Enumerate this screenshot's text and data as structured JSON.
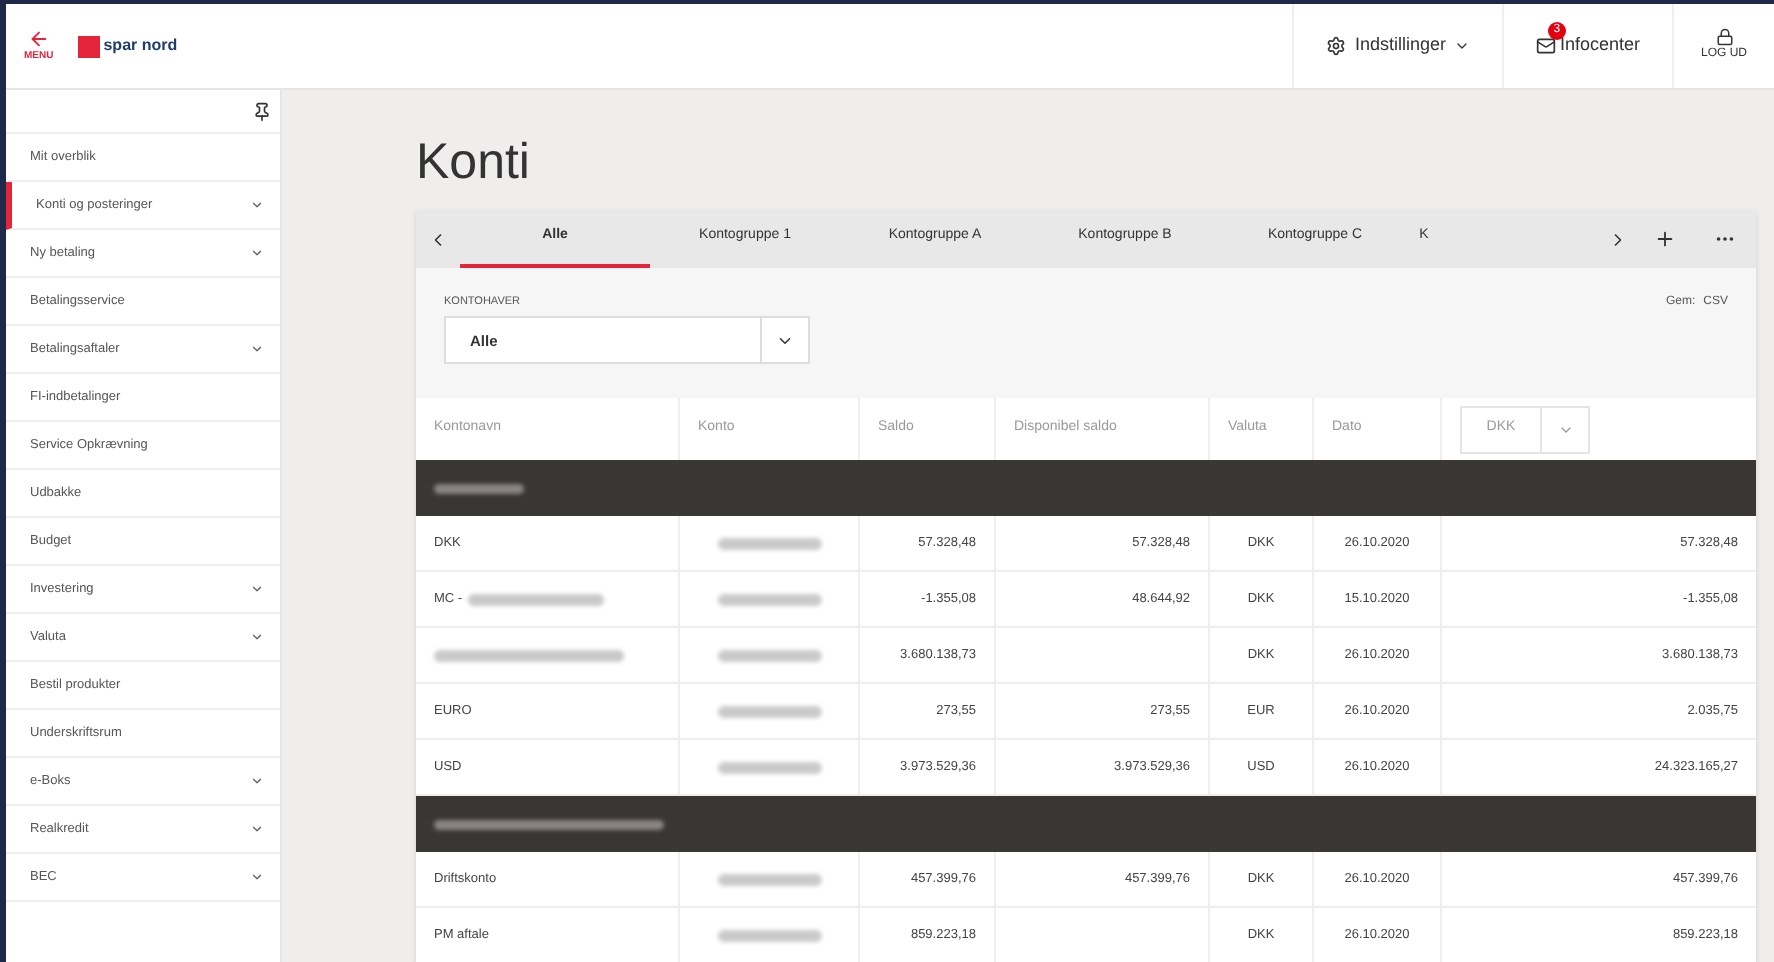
{
  "header": {
    "menu_label": "MENU",
    "logo_text": "spar nord",
    "settings_label": "Indstillinger",
    "infocenter_label": "Infocenter",
    "infocenter_badge": "3",
    "logout_label": "LOG UD"
  },
  "sidebar": {
    "items": [
      {
        "label": "Mit overblik",
        "selected": false,
        "expandable": false
      },
      {
        "label": "Konti og posteringer",
        "selected": true,
        "expandable": true
      },
      {
        "label": "Ny betaling",
        "selected": false,
        "expandable": true
      },
      {
        "label": "Betalingsservice",
        "selected": false,
        "expandable": false
      },
      {
        "label": "Betalingsaftaler",
        "selected": false,
        "expandable": true
      },
      {
        "label": "FI-indbetalinger",
        "selected": false,
        "expandable": false
      },
      {
        "label": "Service Opkrævning",
        "selected": false,
        "expandable": false
      },
      {
        "label": "Udbakke",
        "selected": false,
        "expandable": false
      },
      {
        "label": "Budget",
        "selected": false,
        "expandable": false
      },
      {
        "label": "Investering",
        "selected": false,
        "expandable": true
      },
      {
        "label": "Valuta",
        "selected": false,
        "expandable": true
      },
      {
        "label": "Bestil produkter",
        "selected": false,
        "expandable": false
      },
      {
        "label": "Underskriftsrum",
        "selected": false,
        "expandable": false
      },
      {
        "label": "e-Boks",
        "selected": false,
        "expandable": true
      },
      {
        "label": "Realkredit",
        "selected": false,
        "expandable": true
      },
      {
        "label": "BEC",
        "selected": false,
        "expandable": true
      }
    ]
  },
  "page_title": "Konti",
  "tabs": [
    {
      "label": "Alle",
      "selected": true
    },
    {
      "label": "Kontogruppe 1",
      "selected": false
    },
    {
      "label": "Kontogruppe A",
      "selected": false
    },
    {
      "label": "Kontogruppe B",
      "selected": false
    },
    {
      "label": "Kontogruppe C",
      "selected": false
    },
    {
      "label": "K",
      "selected": false
    }
  ],
  "filter": {
    "label": "KONTOHAVER",
    "value": "Alle",
    "save_label": "Gem:",
    "csv_label": "CSV"
  },
  "table": {
    "columns": [
      "Kontonavn",
      "Konto",
      "Saldo",
      "Disponibel saldo",
      "Valuta",
      "Dato"
    ],
    "currency_select": "DKK",
    "groups": [
      {
        "rows": [
          {
            "name": "DKK",
            "name_redacted": false,
            "saldo": "57.328,48",
            "disponibel": "57.328,48",
            "valuta": "DKK",
            "dato": "26.10.2020",
            "converted": "57.328,48"
          },
          {
            "name": "MC -",
            "name_redacted": true,
            "saldo": "-1.355,08",
            "disponibel": "48.644,92",
            "valuta": "DKK",
            "dato": "15.10.2020",
            "converted": "-1.355,08"
          },
          {
            "name_redacted": true,
            "saldo": "3.680.138,73",
            "valuta": "DKK",
            "dato": "26.10.2020",
            "converted": "3.680.138,73"
          },
          {
            "name": "EURO",
            "name_redacted": false,
            "saldo": "273,55",
            "disponibel": "273,55",
            "valuta": "EUR",
            "dato": "26.10.2020",
            "converted": "2.035,75"
          },
          {
            "name": "USD",
            "name_redacted": false,
            "saldo": "3.973.529,36",
            "disponibel": "3.973.529,36",
            "valuta": "USD",
            "dato": "26.10.2020",
            "converted": "24.323.165,27"
          }
        ]
      },
      {
        "rows": [
          {
            "name": "Driftskonto",
            "name_redacted": false,
            "saldo": "457.399,76",
            "disponibel": "457.399,76",
            "valuta": "DKK",
            "dato": "26.10.2020",
            "converted": "457.399,76"
          },
          {
            "name": "PM aftale",
            "name_redacted": false,
            "saldo": "859.223,18",
            "valuta": "DKK",
            "dato": "26.10.2020",
            "converted": "859.223,18"
          }
        ]
      }
    ]
  }
}
